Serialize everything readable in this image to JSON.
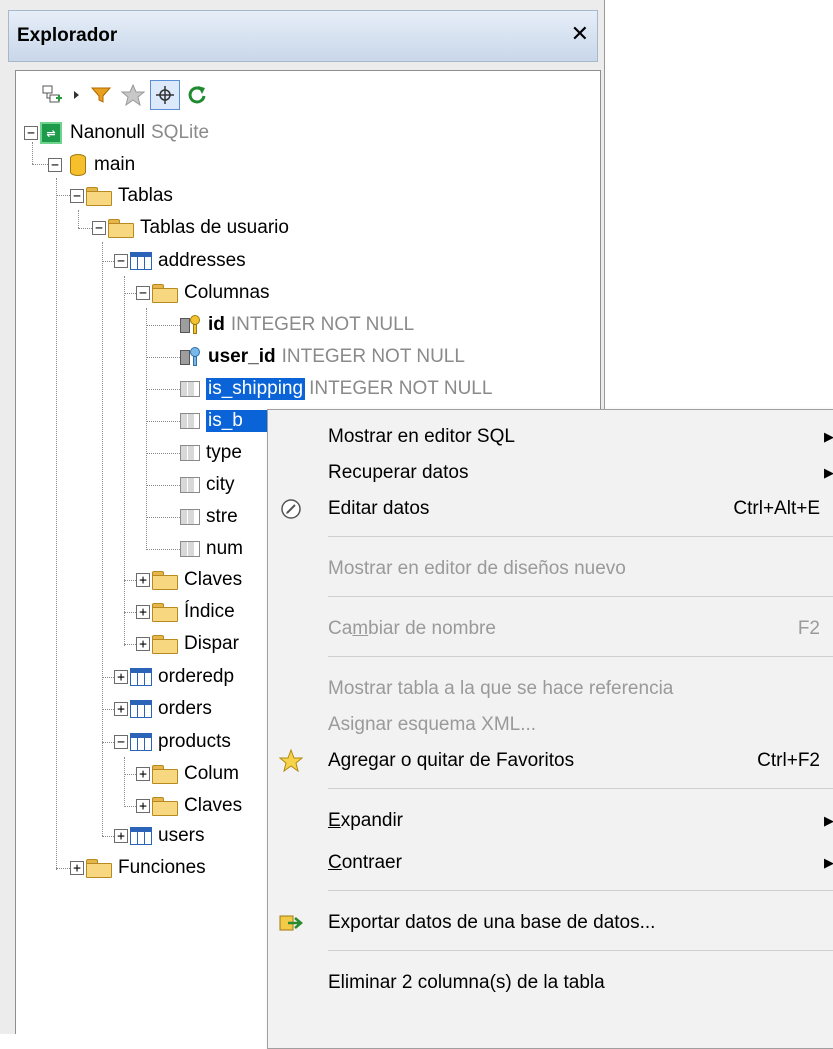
{
  "panel": {
    "title": "Explorador",
    "close": "✕"
  },
  "tree": {
    "root": {
      "name": "Nanonull",
      "type": "SQLite"
    },
    "main": "main",
    "tablas": "Tablas",
    "tablas_usuario": "Tablas de usuario",
    "addresses": "addresses",
    "columnas": "Columnas",
    "columns": [
      {
        "name": "id",
        "type": "INTEGER NOT NULL"
      },
      {
        "name": "user_id",
        "type": "INTEGER NOT NULL"
      },
      {
        "name": "is_shipping",
        "type": "INTEGER NOT NULL"
      },
      {
        "name": "is_b",
        "type": ""
      },
      {
        "name": "type",
        "type": ""
      },
      {
        "name": "city",
        "type": ""
      },
      {
        "name": "stre",
        "type": ""
      },
      {
        "name": "num",
        "type": ""
      }
    ],
    "claves": "Claves",
    "indices": "Índice",
    "disparadores": "Dispar",
    "orderedp": "orderedp",
    "orders": "orders",
    "products": "products",
    "products_columnas": "Colum",
    "products_claves": "Claves",
    "users": "users",
    "funciones": "Funciones"
  },
  "context_menu": {
    "show_sql": "Mostrar en editor SQL",
    "retrieve": "Recuperar datos",
    "edit_data": "Editar datos",
    "edit_data_sc": "Ctrl+Alt+E",
    "show_design": "Mostrar en editor de diseños nuevo",
    "rename_pre": "Ca",
    "rename_u": "m",
    "rename_post": "biar de nombre",
    "rename_sc": "F2",
    "show_ref": "Mostrar tabla a la que se hace referencia",
    "assign_xml": "Asignar esquema XML...",
    "favorites": "Agregar o quitar de Favoritos",
    "favorites_sc": "Ctrl+F2",
    "expand_u": "E",
    "expand_post": "xpandir",
    "collapse_u": "C",
    "collapse_post": "ontraer",
    "export": "Exportar datos de una base de datos...",
    "delete": "Eliminar 2 columna(s) de la tabla"
  },
  "colors": {
    "selection": "#0a64d8",
    "accent_green": "#1e9a4b",
    "folder": "#f7d880"
  }
}
